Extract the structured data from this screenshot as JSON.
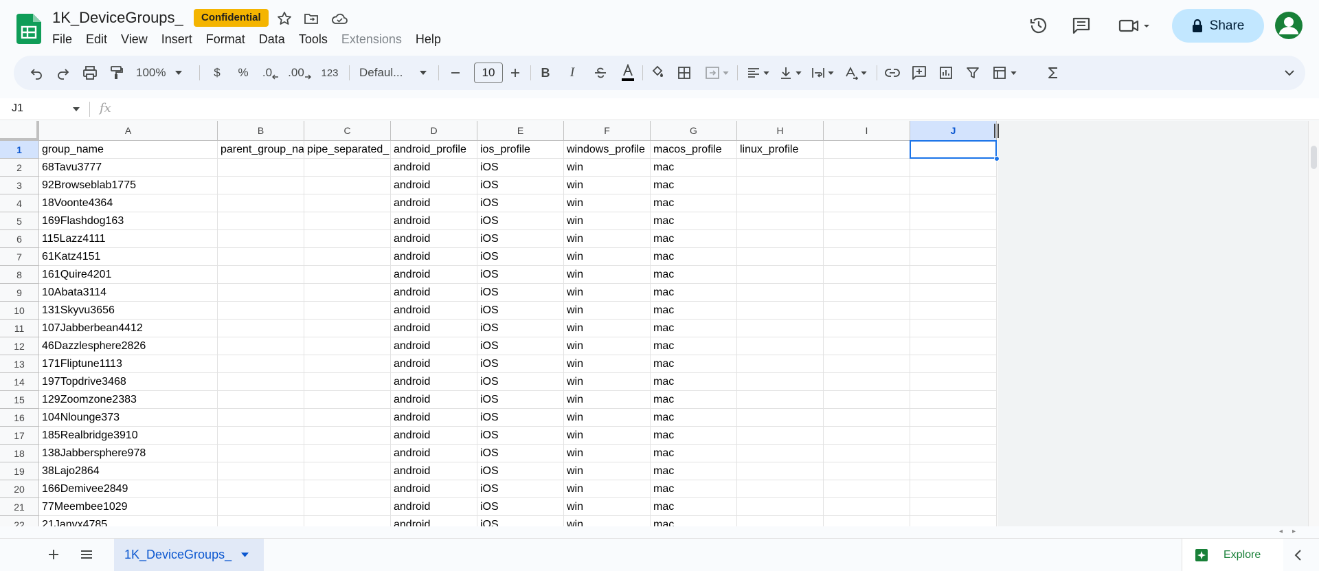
{
  "doc": {
    "title": "1K_DeviceGroups_",
    "badge": "Confidential"
  },
  "menu": [
    "File",
    "Edit",
    "View",
    "Insert",
    "Format",
    "Data",
    "Tools",
    "Extensions",
    "Help"
  ],
  "menu_disabled": [
    "Extensions"
  ],
  "share_label": "Share",
  "toolbar": {
    "zoom": "100%",
    "currency": "$",
    "percent": "%",
    "dec_decrease": ".0",
    "dec_increase": ".00",
    "more_formats": "123",
    "font": "Defaul...",
    "font_size": "10",
    "bold": "B",
    "italic": "I"
  },
  "formula": {
    "namebox": "J1",
    "fx": "fx",
    "value": ""
  },
  "columns": [
    "A",
    "B",
    "C",
    "D",
    "E",
    "F",
    "G",
    "H",
    "I",
    "J"
  ],
  "selected_column": "J",
  "header_row": [
    "group_name",
    "parent_group_na",
    "pipe_separated_",
    "android_profile",
    "ios_profile",
    "windows_profile",
    "macos_profile",
    "linux_profile",
    "",
    ""
  ],
  "rows": [
    [
      "68Tavu3777",
      "",
      "",
      "android",
      "iOS",
      "win",
      "mac",
      "",
      "",
      ""
    ],
    [
      "92Browseblab1775",
      "",
      "",
      "android",
      "iOS",
      "win",
      "mac",
      "",
      "",
      ""
    ],
    [
      "18Voonte4364",
      "",
      "",
      "android",
      "iOS",
      "win",
      "mac",
      "",
      "",
      ""
    ],
    [
      "169Flashdog163",
      "",
      "",
      "android",
      "iOS",
      "win",
      "mac",
      "",
      "",
      ""
    ],
    [
      "115Lazz4111",
      "",
      "",
      "android",
      "iOS",
      "win",
      "mac",
      "",
      "",
      ""
    ],
    [
      "61Katz4151",
      "",
      "",
      "android",
      "iOS",
      "win",
      "mac",
      "",
      "",
      ""
    ],
    [
      "161Quire4201",
      "",
      "",
      "android",
      "iOS",
      "win",
      "mac",
      "",
      "",
      ""
    ],
    [
      "10Abata3114",
      "",
      "",
      "android",
      "iOS",
      "win",
      "mac",
      "",
      "",
      ""
    ],
    [
      "131Skyvu3656",
      "",
      "",
      "android",
      "iOS",
      "win",
      "mac",
      "",
      "",
      ""
    ],
    [
      "107Jabberbean4412",
      "",
      "",
      "android",
      "iOS",
      "win",
      "mac",
      "",
      "",
      ""
    ],
    [
      "46Dazzlesphere2826",
      "",
      "",
      "android",
      "iOS",
      "win",
      "mac",
      "",
      "",
      ""
    ],
    [
      "171Fliptune1113",
      "",
      "",
      "android",
      "iOS",
      "win",
      "mac",
      "",
      "",
      ""
    ],
    [
      "197Topdrive3468",
      "",
      "",
      "android",
      "iOS",
      "win",
      "mac",
      "",
      "",
      ""
    ],
    [
      "129Zoomzone2383",
      "",
      "",
      "android",
      "iOS",
      "win",
      "mac",
      "",
      "",
      ""
    ],
    [
      "104Nlounge373",
      "",
      "",
      "android",
      "iOS",
      "win",
      "mac",
      "",
      "",
      ""
    ],
    [
      "185Realbridge3910",
      "",
      "",
      "android",
      "iOS",
      "win",
      "mac",
      "",
      "",
      ""
    ],
    [
      "138Jabbersphere978",
      "",
      "",
      "android",
      "iOS",
      "win",
      "mac",
      "",
      "",
      ""
    ],
    [
      "38Lajo2864",
      "",
      "",
      "android",
      "iOS",
      "win",
      "mac",
      "",
      "",
      ""
    ],
    [
      "166Demivee2849",
      "",
      "",
      "android",
      "iOS",
      "win",
      "mac",
      "",
      "",
      ""
    ],
    [
      "77Meembee1029",
      "",
      "",
      "android",
      "iOS",
      "win",
      "mac",
      "",
      "",
      ""
    ],
    [
      "21Janyx4785",
      "",
      "",
      "android",
      "iOS",
      "win",
      "mac",
      "",
      "",
      ""
    ]
  ],
  "sheet_tab": "1K_DeviceGroups_",
  "explore_label": "Explore",
  "colors": {
    "accent": "#0b57d0",
    "share_bg": "#c2e7ff",
    "badge": "#f4b400",
    "sheets_green": "#188038",
    "selection": "#1a73e8"
  }
}
